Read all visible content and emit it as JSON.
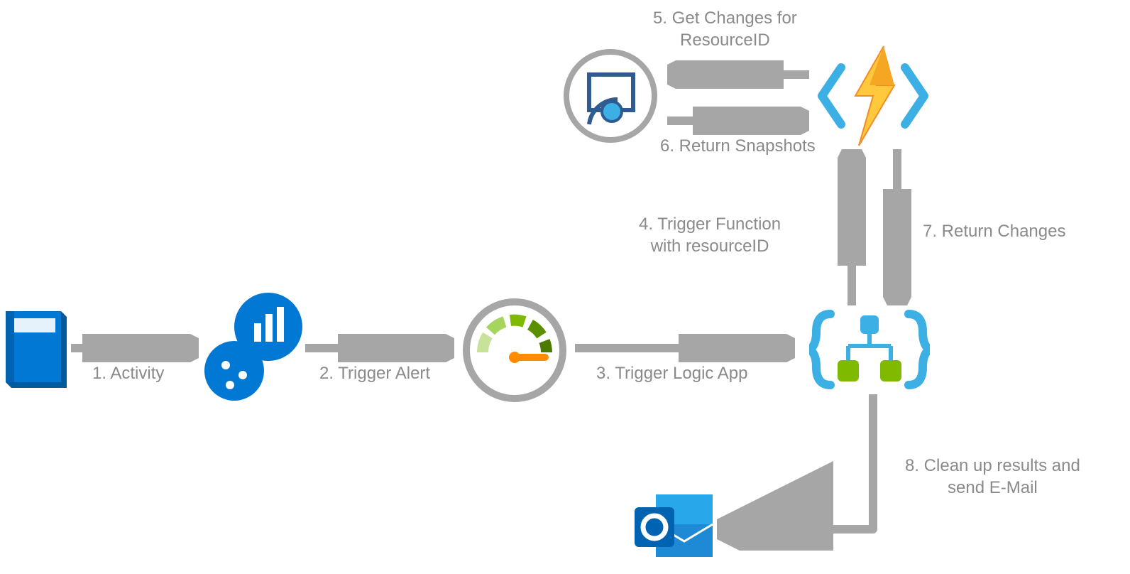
{
  "labels": {
    "step1": "1. Activity",
    "step2": "2. Trigger Alert",
    "step3": "3. Trigger Logic App",
    "step4": "4. Trigger Function\nwith resourceID",
    "step5": "5. Get Changes for\nResourceID",
    "step6": "6. Return Snapshots",
    "step7": "7. Return Changes",
    "step8": "8. Clean up results and\nsend E-Mail"
  },
  "colors": {
    "arrow": "#a6a6a6",
    "text": "#8a8a8a",
    "azureBlue": "#0078d4",
    "logicBlue": "#3cb0e5",
    "logicGreen": "#7fba00",
    "gaugeGray": "#a6a6a6",
    "gaugeGreen": "#7fba00",
    "gaugeOrange": "#ff8c00",
    "funcYellow": "#ffc83d",
    "funcOrange": "#f28c28",
    "outlookBlue": "#28a8ea",
    "outlookDark": "#1070ca"
  }
}
